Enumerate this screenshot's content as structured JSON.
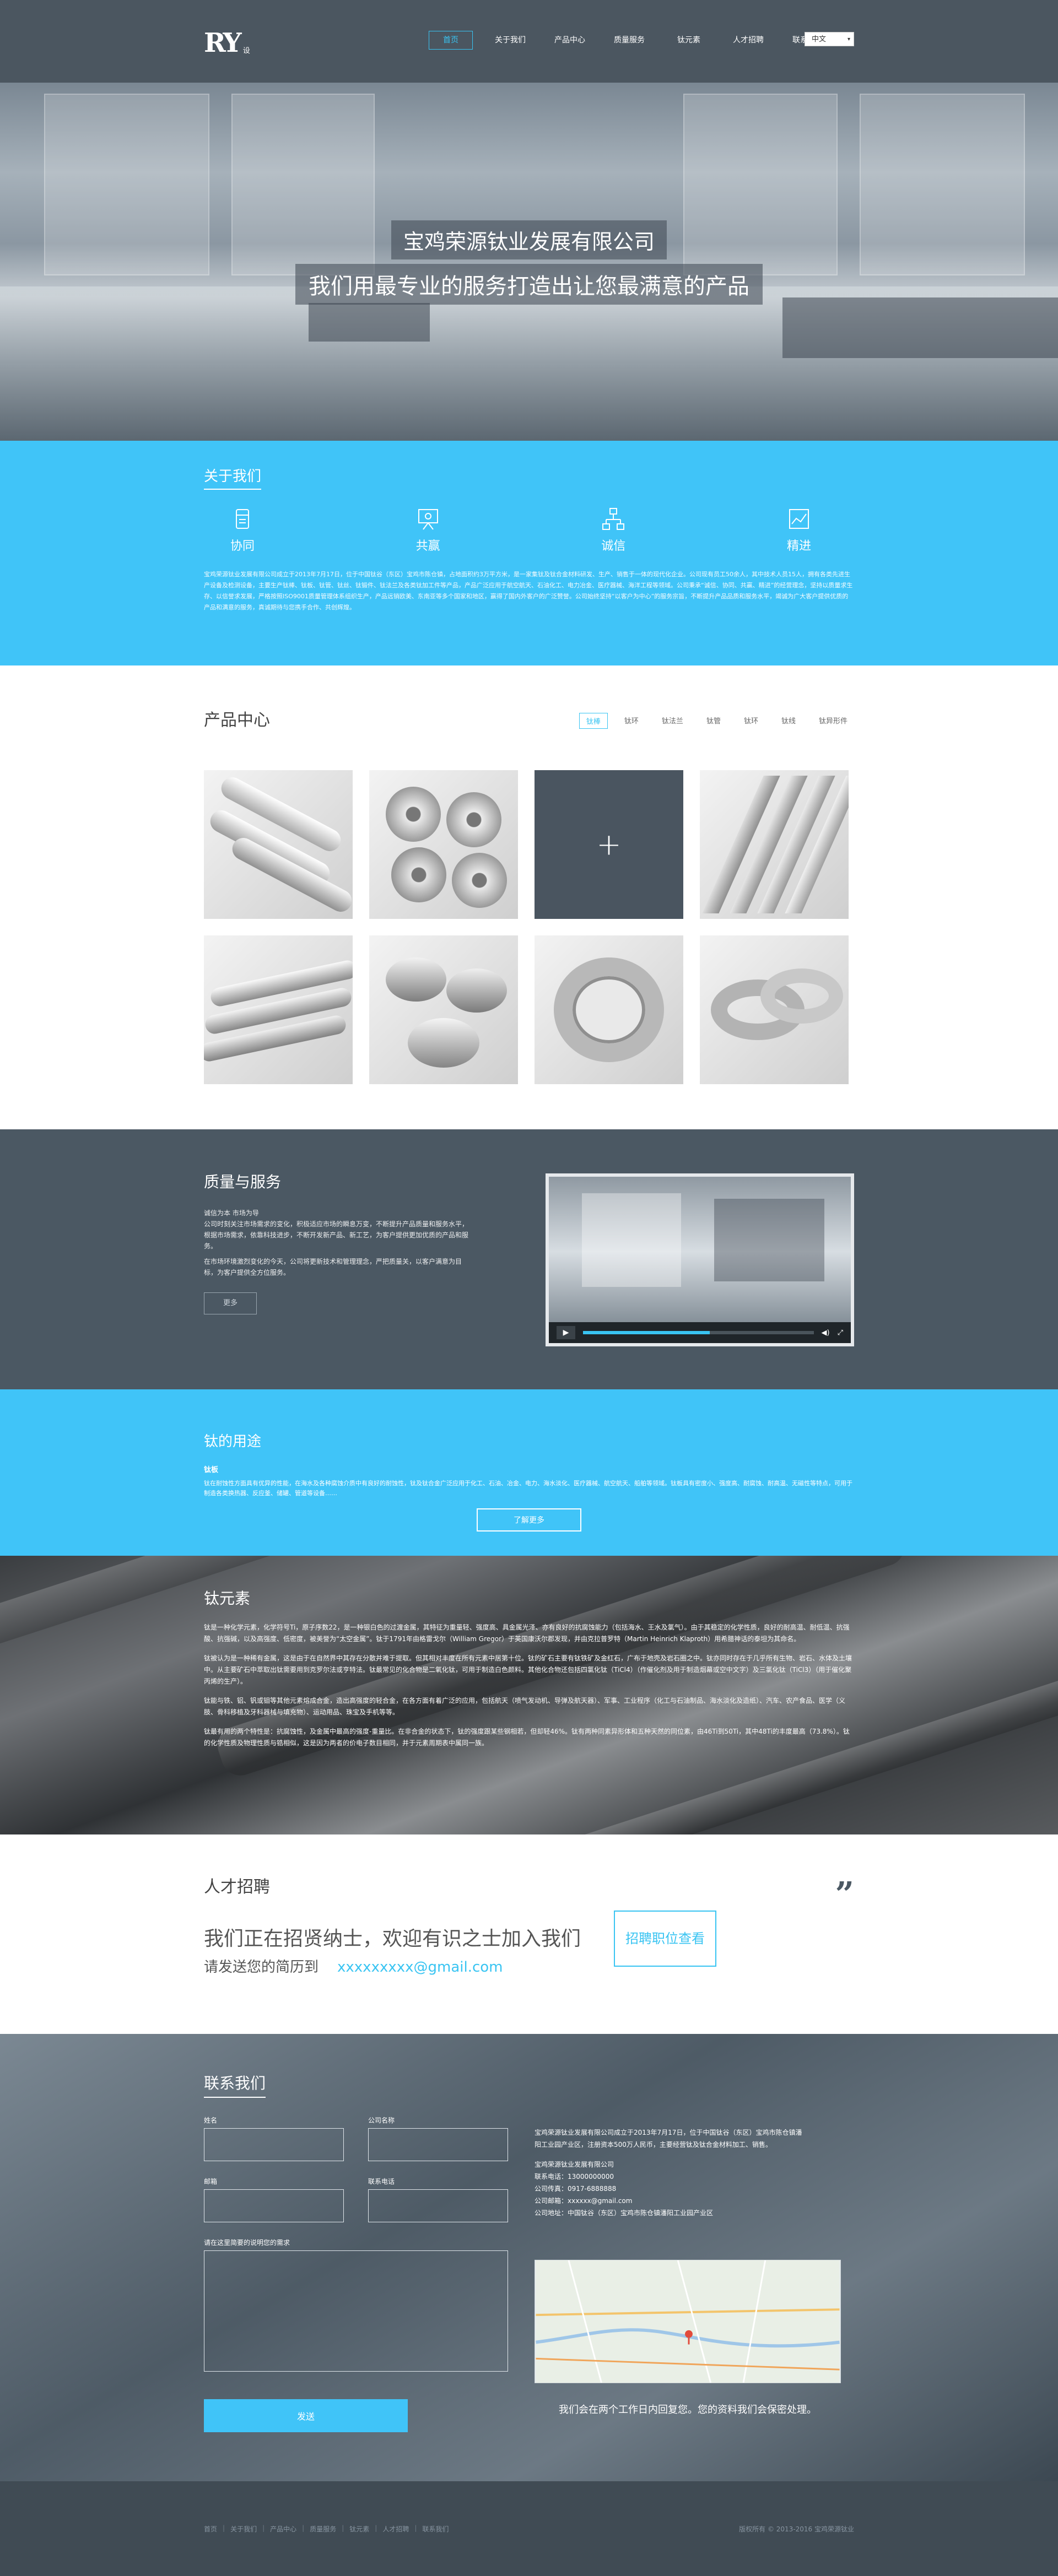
{
  "brand": {
    "logo": "RY",
    "logo_sub": "设"
  },
  "nav": {
    "items": [
      "首页",
      "关于我们",
      "产品中心",
      "质量服务",
      "钛元素",
      "人才招聘",
      "联系我们"
    ],
    "lang": "中文"
  },
  "hero": {
    "title": "宝鸡荣源钛业发展有限公司",
    "subtitle": "我们用最专业的服务打造出让您最满意的产品"
  },
  "about": {
    "title": "关于我们",
    "icons": [
      {
        "label": "协同",
        "icon": "cup-icon"
      },
      {
        "label": "共赢",
        "icon": "presentation-icon"
      },
      {
        "label": "诚信",
        "icon": "network-icon"
      },
      {
        "label": "精进",
        "icon": "chart-icon"
      }
    ],
    "text": "宝鸡荣源钛业发展有限公司成立于2013年7月17日，位于中国钛谷（东区）宝鸡市陈仓镇，占地面积约3万平方米，是一家集钛及钛合金材料研发、生产、销售于一体的现代化企业。公司现有员工50余人，其中技术人员15人，拥有各类先进生产设备及检测设备，主要生产钛棒、钛板、钛管、钛丝、钛锻件、钛法兰及各类钛加工件等产品，产品广泛应用于航空航天、石油化工、电力冶金、医疗器械、海洋工程等领域。公司秉承“诚信、协同、共赢、精进”的经营理念，坚持以质量求生存、以信誉求发展，严格按照ISO9001质量管理体系组织生产，产品远销欧美、东南亚等多个国家和地区，赢得了国内外客户的广泛赞誉。公司始终坚持“以客户为中心”的服务宗旨，不断提升产品品质和服务水平，竭诚为广大客户提供优质的产品和满意的服务，真诚期待与您携手合作、共创辉煌。"
  },
  "products": {
    "title": "产品中心",
    "tabs": [
      "钛棒",
      "钛环",
      "钛法兰",
      "钛管",
      "钛环",
      "钛线",
      "钛异形件"
    ],
    "items": [
      "钛棒",
      "钛法兰",
      "",
      "钛板",
      "钛管",
      "钛饼",
      "钛丝",
      "钛环"
    ]
  },
  "service": {
    "title": "质量与服务",
    "sub": "诚信为本 市场为导",
    "p1": "公司时刻关注市场需求的变化，积极适应市场的瞬息万变，不断提升产品质量和服务水平，根据市场需求，依靠科技进步，不断开发新产品、新工艺，为客户提供更加优质的产品和服务。",
    "p2": "在市场环境激烈变化的今天，公司将更新技术和管理理念，严把质量关，以客户满意为目标，为客户提供全方位服务。",
    "button": "更多"
  },
  "uses": {
    "title": "钛的用途",
    "sub": "钛板",
    "text": "钛在耐蚀性方面具有优异的性能，在海水及各种腐蚀介质中有良好的耐蚀性，钛及钛合金广泛应用于化工、石油、冶金、电力、海水淡化、医疗器械、航空航天、船舶等领域。钛板具有密度小、强度高、耐腐蚀、耐高温、无磁性等特点，可用于制造各类换热器、反应釜、储罐、管道等设备……",
    "button": "了解更多"
  },
  "element": {
    "title": "钛元素",
    "paras": [
      "钛是一种化学元素，化学符号Ti，原子序数22，是一种银白色的过渡金属，其特征为重量轻、强度高、具金属光泽、亦有良好的抗腐蚀能力（包括海水、王水及氯气）。由于其稳定的化学性质，良好的耐高温、耐低温、抗强酸、抗强碱，以及高强度、低密度，被美誉为“太空金属”。钛于1791年由格雷戈尔（William Gregor）于英国康沃尔郡发现，并由克拉普罗特（Martin Heinrich Klaproth）用希腊神话的泰坦为其命名。",
      "钛被认为是一种稀有金属，这是由于在自然界中其存在分散并难于提取。但其相对丰度在所有元素中居第十位。钛的矿石主要有钛铁矿及金红石，广布于地壳及岩石圈之中。钛亦同时存在于几乎所有生物、岩石、水体及土壤中。从主要矿石中萃取出钛需要用到克罗尔法或亨特法。钛最常见的化合物是二氧化钛，可用于制造白色颜料。其他化合物还包括四氯化钛（TiCl4）（作催化剂及用于制造烟幕或空中文字）及三氯化钛（TiCl3）（用于催化聚丙烯的生产）。",
      "钛能与铁、铝、钒或钼等其他元素熔成合金，造出高强度的轻合金，在各方面有着广泛的应用，包括航天（喷气发动机、导弹及航天器）、军事、工业程序（化工与石油制品、海水淡化及造纸）、汽车、农产食品、医学（义肢、骨科移植及牙科器械与填充物）、运动用品、珠宝及手机等等。",
      "钛最有用的两个特性是：抗腐蚀性，及金属中最高的强度-重量比。在非合金的状态下，钛的强度跟某些钢相若，但却轻46%。钛有两种同素异形体和五种天然的同位素，由46Ti到50Ti，其中48Ti的丰度最高（73.8%）。钛的化学性质及物理性质与锆相似，这是因为两者的价电子数目相同，并于元素周期表中属同一族。"
    ]
  },
  "career": {
    "title": "人才招聘",
    "headline": "我们正在招贤纳士，欢迎有识之士加入我们",
    "mail_prefix": "请发送您的简历到",
    "mail": "xxxxxxxxx@gmail.com",
    "button": "招聘职位查看"
  },
  "contact": {
    "title": "联系我们",
    "labels": {
      "name": "姓名",
      "company": "公司名称",
      "email": "邮箱",
      "phone": "联系电话",
      "message": "请在这里简要的说明您的需求"
    },
    "submit": "发送",
    "info": [
      "宝鸡荣源钛业发展有限公司成立于2013年7月17日，位于中国钛谷（东区）宝鸡市陈仓镇潘",
      "阳工业园产业区，注册资本500万人民币，主要经营钛及钛合金材料加工、销售。",
      "宝鸡荣源钛业发展有限公司",
      "联系电话：13000000000",
      "公司传真：0917-6888888",
      "公司邮箱：xxxxxx@gmail.com",
      "公司地址：中国钛谷（东区）宝鸡市陈仓镇潘阳工业园产业区"
    ],
    "map_marker": "宝鸡荣源钛业",
    "tip": "我们会在两个工作日内回复您。您的资料我们会保密处理。"
  },
  "footer": {
    "links": [
      "首页",
      "关于我们",
      "产品中心",
      "质量服务",
      "钛元素",
      "人才招聘",
      "联系我们"
    ],
    "copyright": "版权所有 © 2013-2016 宝鸡荣源钛业"
  },
  "colors": {
    "accent": "#40c4f8",
    "nav": "#4b5660",
    "dark": "#4b5863"
  }
}
